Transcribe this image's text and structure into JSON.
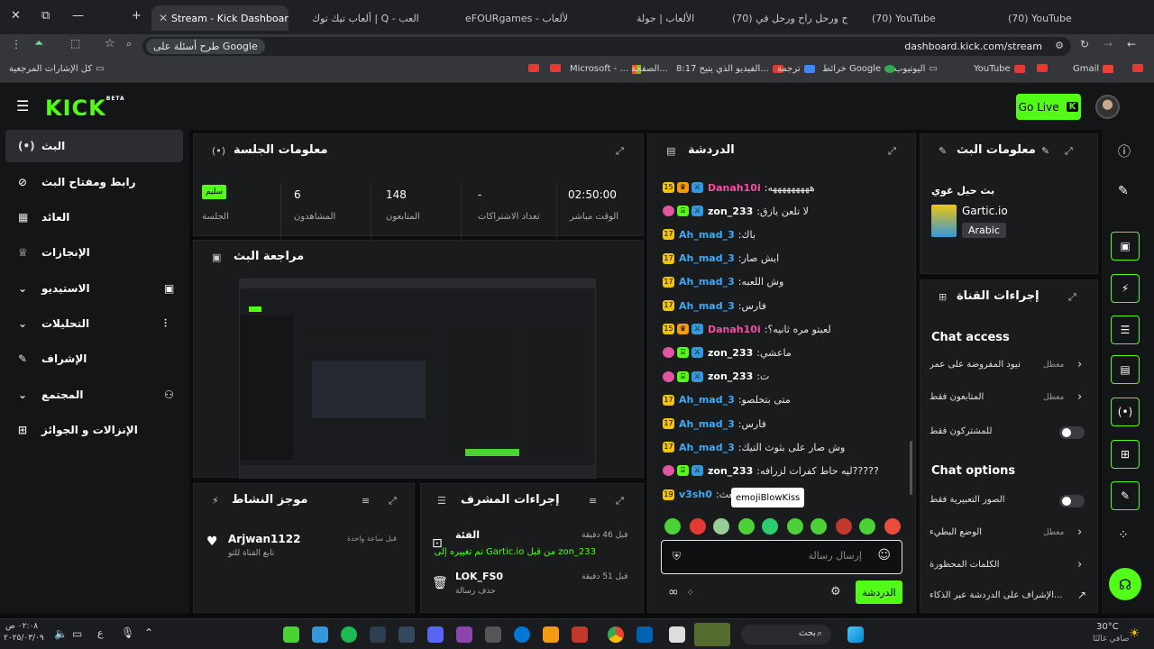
{
  "browser": {
    "tabs": [
      {
        "label": "Stream - Kick Dashboard",
        "active": true
      },
      {
        "label": "ألعاب تيك توك | Q - العب"
      },
      {
        "label": "eFOURgames - الألعاب"
      },
      {
        "label": "الألعاب | جولة"
      },
      {
        "label": "(70) راح ورحل راح ورحل في"
      },
      {
        "label": "(70) YouTube"
      },
      {
        "label": "(70) YouTube"
      }
    ],
    "url": "dashboard.kick.com/stream",
    "google_pill": "طرح أسئلة على Google",
    "bookmarks": [
      "كل الإشارات المرجعية",
      "Microsoft - ...",
      "الصفحة...",
      "8:17 الفيديو الذي يتيح...",
      "ترجمة",
      "خرائط Google",
      "اليوتيوب",
      "YouTube",
      "Gmail"
    ]
  },
  "header": {
    "logo": "KICK",
    "logo_badge": "BETA",
    "go_live": "Go Live"
  },
  "sidebar": {
    "items": [
      {
        "label": "البث",
        "icon": "broadcast-icon",
        "glyph": "(•)"
      },
      {
        "label": "رابط ومفتاح البث",
        "icon": "link-icon",
        "glyph": "⊘"
      },
      {
        "label": "العائد",
        "icon": "revenue-icon",
        "glyph": "▦"
      },
      {
        "label": "الإنجازات",
        "icon": "trophy-icon",
        "glyph": "♕"
      },
      {
        "label": "الاستيديو",
        "icon": "studio-icon",
        "glyph": "▣"
      },
      {
        "label": "التحليلات",
        "icon": "analytics-icon",
        "glyph": "⫶"
      },
      {
        "label": "الإشراف",
        "icon": "moderation-icon",
        "glyph": "✎"
      },
      {
        "label": "المجتمع",
        "icon": "community-icon",
        "glyph": "⚇"
      },
      {
        "label": "الإنزالات و الجوائز",
        "icon": "drops-icon",
        "glyph": "⊞"
      }
    ]
  },
  "session": {
    "title": "معلومات الجلسة",
    "stats": [
      {
        "value": "02:50:00",
        "label": "الوقت مباشر"
      },
      {
        "value": "-",
        "label": "تعداد الاشتراكات"
      },
      {
        "value": "148",
        "label": "المتابعون"
      },
      {
        "value": "6",
        "label": "المشاهدون"
      },
      {
        "value": "سليم",
        "label": "الجلسة"
      }
    ]
  },
  "preview": {
    "title": "مراجعة البث"
  },
  "activity": {
    "title": "موجز النشاط",
    "items": [
      {
        "user": "Arjwan1122",
        "text": "تابع القناة للتو",
        "time": "قبل ساعة واحدة"
      }
    ]
  },
  "modactions": {
    "title": "إجراءات المشرف",
    "items": [
      {
        "title": "الفئة",
        "time": "قبل 46 دقيقة",
        "desc": "zon_233 من قبل Gartic.io تم تغييره إلى"
      },
      {
        "title": "LOK_FS0",
        "time": "قبل 51 دقيقة",
        "desc": "حذف رسالة"
      }
    ]
  },
  "chat": {
    "title": "الدردشة",
    "messages": [
      {
        "user": "Danah10i",
        "color": "#f54ea2",
        "badge": "15",
        "crown": true,
        "text": "هههههههههه"
      },
      {
        "user": "zon_233",
        "color": "#ffffff",
        "badge": "mod",
        "text": "لا تلعن يازق"
      },
      {
        "user": "Ah_mad_3",
        "color": "#3fa9f5",
        "badge": "17",
        "text": "باك"
      },
      {
        "user": "Ah_mad_3",
        "color": "#3fa9f5",
        "badge": "17",
        "text": "ايش صار"
      },
      {
        "user": "Ah_mad_3",
        "color": "#3fa9f5",
        "badge": "17",
        "text": "وش اللعبه"
      },
      {
        "user": "Ah_mad_3",
        "color": "#3fa9f5",
        "badge": "17",
        "text": "فارس"
      },
      {
        "user": "Danah10i",
        "color": "#f54ea2",
        "badge": "15",
        "crown": true,
        "text": "لعبتو مره ثانيه؟"
      },
      {
        "user": "zon_233",
        "color": "#ffffff",
        "badge": "mod",
        "text": "ماعشي"
      },
      {
        "user": "zon_233",
        "color": "#ffffff",
        "badge": "mod",
        "text": "ت"
      },
      {
        "user": "Ah_mad_3",
        "color": "#3fa9f5",
        "badge": "17",
        "text": "متى بتخلصو"
      },
      {
        "user": "Ah_mad_3",
        "color": "#3fa9f5",
        "badge": "17",
        "text": "فارس"
      },
      {
        "user": "Ah_mad_3",
        "color": "#3fa9f5",
        "badge": "17",
        "text": "وش صار على بثوث التيك"
      },
      {
        "user": "zon_233",
        "color": "#ffffff",
        "badge": "mod",
        "text": "ليه حاط كفرات لزرافه?????"
      },
      {
        "user": "v3sh0",
        "color": "#3fa9f5",
        "badge": "19",
        "text": "بعث"
      }
    ],
    "tooltip": "emojiBlowKiss",
    "input_placeholder": "إرسال رسالة",
    "send": "الدردشة"
  },
  "stream_info": {
    "title": "معلومات البث",
    "stream_title": "بث حيل غوي",
    "category": "Gartic.io",
    "language": "Arabic"
  },
  "channel_actions": {
    "title": "إجراءات القناة",
    "access_header": "Chat access",
    "access": [
      {
        "label": "القيود المفروضة على عمر...",
        "value": "معطل"
      },
      {
        "label": "المتابعون فقط",
        "value": "معطل"
      },
      {
        "label": "للمشتركون فقط",
        "value": ""
      }
    ],
    "options_header": "Chat options",
    "options": [
      {
        "label": "الصور التعبيرية فقط",
        "value": ""
      },
      {
        "label": "الوضع البطيء",
        "value": "معطل"
      },
      {
        "label": "الكلمات المحظورة",
        "value": ""
      },
      {
        "label": "الإشراف على الدردشة عبر الذكاء...",
        "value": ""
      }
    ]
  },
  "taskbar": {
    "weather_temp": "30°C",
    "weather_desc": "صافي غالبًا",
    "time": "٠٢:٠٨ ص",
    "date": "٢٠٢٥/٠٣/٠٩",
    "search": "بحث",
    "lang": "ع"
  },
  "colors": {
    "accent": "#53fc18",
    "bg": "#0b0c0d",
    "panel": "#191b1d"
  }
}
